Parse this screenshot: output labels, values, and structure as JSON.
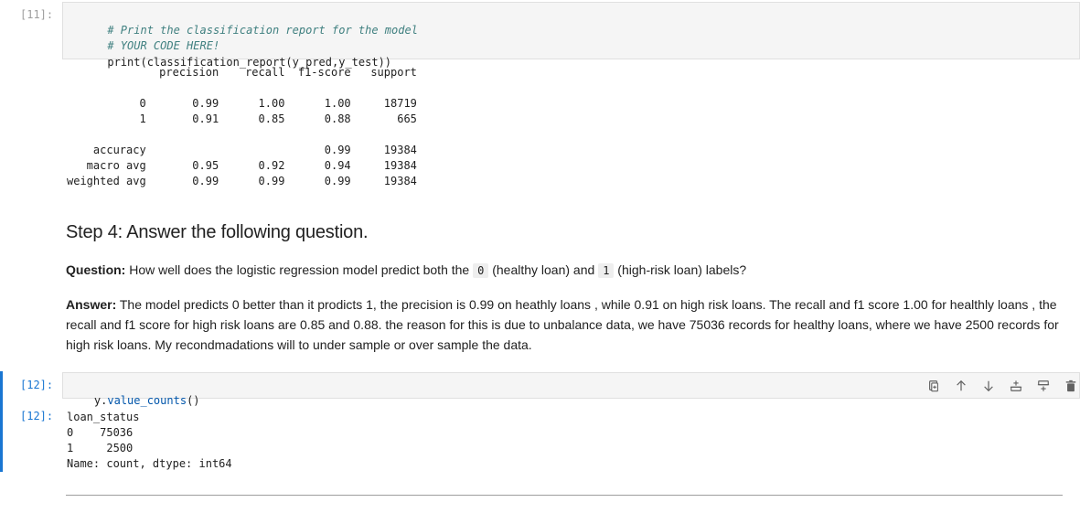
{
  "cell11": {
    "prompt": "[11]:",
    "code": {
      "comment1": "# Print the classification report for the model",
      "comment2": "# YOUR CODE HERE!",
      "line3_fn": "print",
      "line3_rest": "(classification_report(y_pred,y_test))"
    },
    "output": "              precision    recall  f1-score   support\n\n           0       0.99      1.00      1.00     18719\n           1       0.91      0.85      0.88       665\n\n    accuracy                           0.99     19384\n   macro avg       0.95      0.92      0.94     19384\nweighted avg       0.99      0.99      0.99     19384"
  },
  "markdown": {
    "heading": "Step 4: Answer the following question.",
    "question_label": "Question:",
    "question_part1": " How well does the logistic regression model predict both the ",
    "question_code1": "0",
    "question_part2": " (healthy loan) and ",
    "question_code2": "1",
    "question_part3": " (high-risk loan) labels?",
    "answer_label": "Answer:",
    "answer_text": " The model predicts 0 better than it prodicts 1, the precision is 0.99 on heathly loans , while 0.91 on high risk loans. The recall and f1 score 1.00 for healthly loans , the recall and f1 score for high risk loans are 0.85 and 0.88. the reason for this is due to unbalance data, we have 75036 records for healthy loans, where we have 2500 records for high risk loans. My recondmadations will to under sample or over sample the data."
  },
  "cell12": {
    "prompt_in": "[12]:",
    "prompt_out": "[12]:",
    "code_obj": "y.",
    "code_fn": "value_counts",
    "code_paren": "()",
    "output": "loan_status\n0    75036\n1     2500\nName: count, dtype: int64"
  },
  "toolbar": {
    "icons": [
      "duplicate-icon",
      "move-up-icon",
      "move-down-icon",
      "insert-above-icon",
      "insert-below-icon",
      "delete-icon"
    ]
  },
  "colors": {
    "active": "#1976d2",
    "editor_bg": "#f5f5f5",
    "comment": "#408080"
  }
}
